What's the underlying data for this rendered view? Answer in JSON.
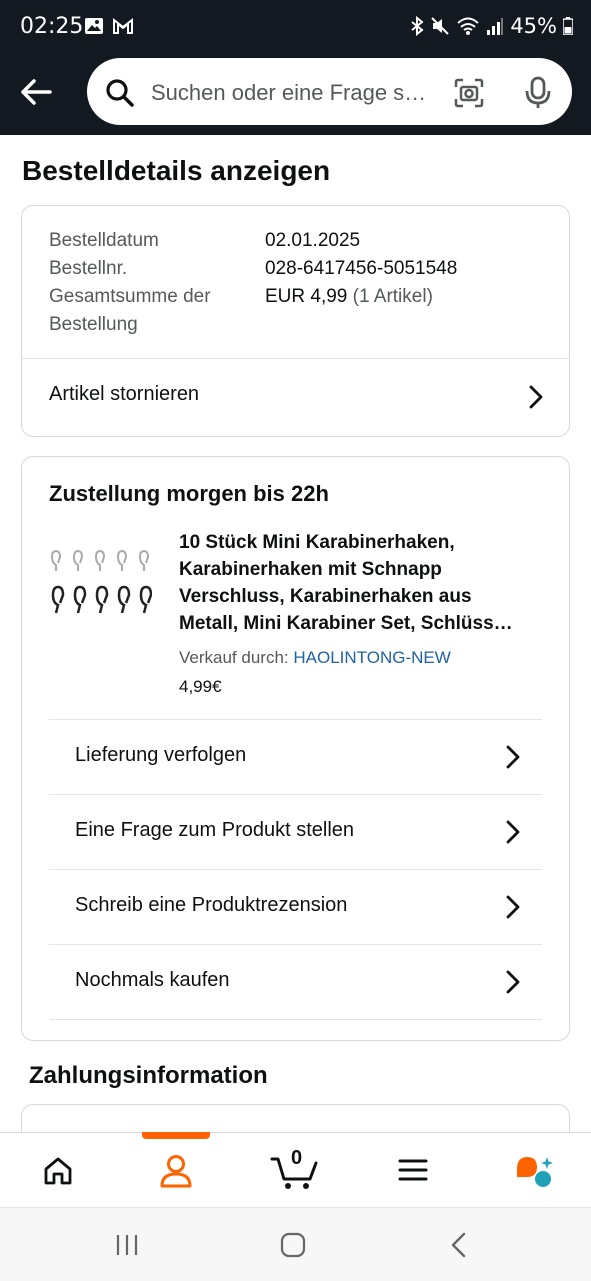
{
  "status_bar": {
    "time": "02:25",
    "battery": "45%"
  },
  "search": {
    "placeholder": "Suchen oder eine Frage s…"
  },
  "page": {
    "title": "Bestelldetails anzeigen"
  },
  "order": {
    "date_label": "Bestelldatum",
    "date_value": "02.01.2025",
    "number_label": "Bestellnr.",
    "number_value": "028-6417456-5051548",
    "total_label_line1": "Gesamtsumme der",
    "total_label_line2": "Bestellung",
    "total_value": "EUR 4,99",
    "total_items": "(1 Artikel)",
    "cancel_label": "Artikel stornieren"
  },
  "delivery": {
    "title": "Zustellung morgen bis 22h",
    "product": {
      "title_lines": [
        "10 Stück Mini Karabinerhaken,",
        "Karabinerhaken mit Schnapp",
        "Verschluss, Karabinerhaken aus",
        "Metall, Mini Karabiner Set, Schlüss…"
      ],
      "seller_prefix": "Verkauf durch:",
      "seller_name": "HAOLINTONG-NEW",
      "price": "4,99€"
    },
    "actions": [
      "Lieferung verfolgen",
      "Eine Frage zum Produkt stellen",
      "Schreib eine Produktrezension",
      "Nochmals kaufen"
    ]
  },
  "payment": {
    "title": "Zahlungsinformation"
  },
  "tabbar": {
    "cart_count": "0",
    "active": "account"
  },
  "colors": {
    "header": "#131921",
    "accent": "#ff6200",
    "link": "#2162a1",
    "rufus_orange": "#ff6200",
    "rufus_teal": "#1fa2b8"
  }
}
